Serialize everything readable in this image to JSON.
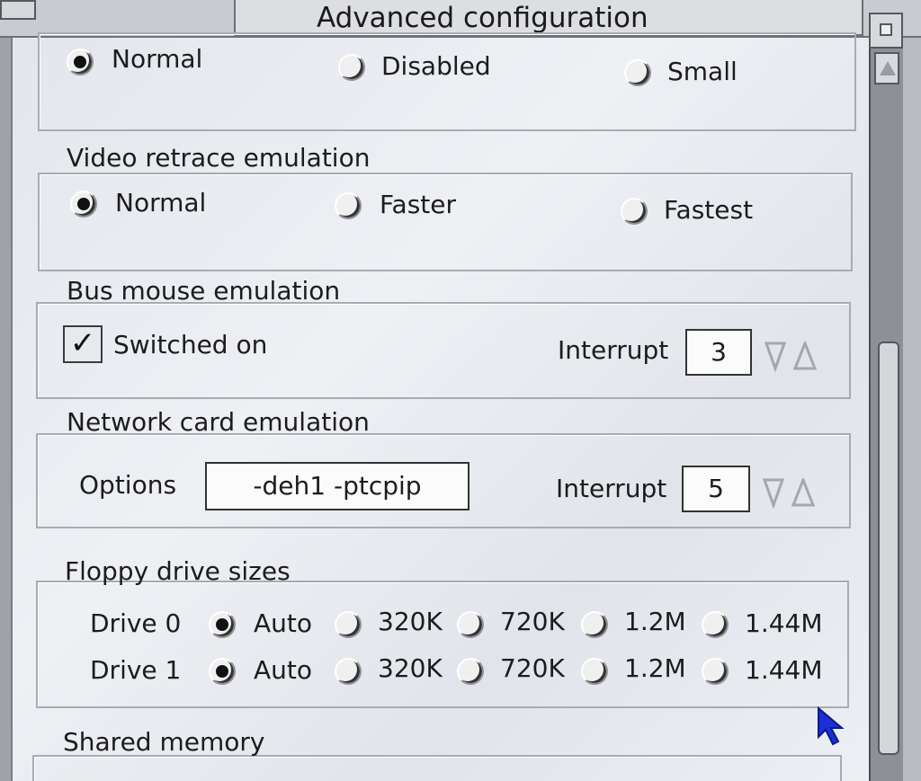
{
  "window": {
    "title": "Advanced configuration"
  },
  "top_group": {
    "options": [
      {
        "label": "Normal",
        "selected": true
      },
      {
        "label": "Disabled",
        "selected": false
      },
      {
        "label": "Small",
        "selected": false
      }
    ]
  },
  "video_retrace": {
    "title": "Video retrace emulation",
    "options": [
      {
        "label": "Normal",
        "selected": true
      },
      {
        "label": "Faster",
        "selected": false
      },
      {
        "label": "Fastest",
        "selected": false
      }
    ]
  },
  "bus_mouse": {
    "title": "Bus mouse emulation",
    "checkbox_label": "Switched on",
    "checked": true,
    "interrupt_label": "Interrupt",
    "interrupt_value": "3"
  },
  "network_card": {
    "title": "Network card emulation",
    "options_label": "Options",
    "options_value": "-deh1 -ptcpip",
    "interrupt_label": "Interrupt",
    "interrupt_value": "5"
  },
  "floppy": {
    "title": "Floppy drive sizes",
    "drives": [
      {
        "label": "Drive 0",
        "sizes": [
          "Auto",
          "320K",
          "720K",
          "1.2M",
          "1.44M"
        ],
        "selected": "Auto"
      },
      {
        "label": "Drive 1",
        "sizes": [
          "Auto",
          "320K",
          "720K",
          "1.2M",
          "1.44M"
        ],
        "selected": "Auto"
      }
    ]
  },
  "shared_memory": {
    "title": "Shared memory"
  },
  "icons": {
    "checkmark": "✓",
    "cursor": "pointer-arrow-icon"
  },
  "colors": {
    "pane_bg": "#e8ebf0",
    "cursor": "#1c2fd6"
  }
}
